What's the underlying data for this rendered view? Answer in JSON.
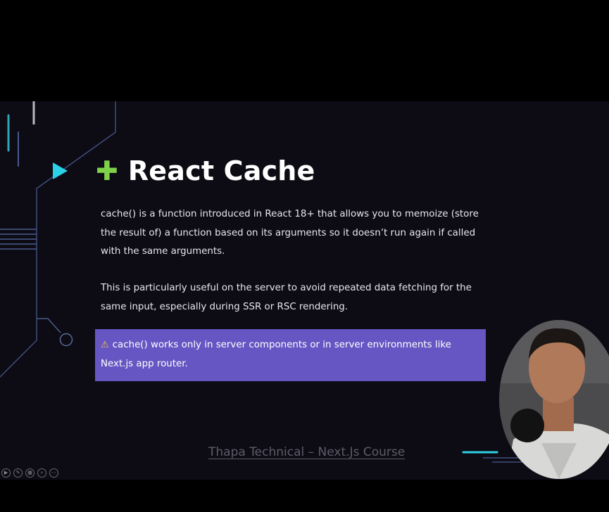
{
  "slide": {
    "title": "React Cache",
    "paragraph_1": "cache() is a function introduced in React 18+ that allows you to memoize (store the result of) a function based on its arguments so it doesn’t run again if called with the same arguments.",
    "paragraph_2": "This is particularly useful on the server to avoid repeated data fetching for the same input, especially during SSR or RSC rendering.",
    "callout": {
      "icon": "warning-icon",
      "text": "cache() works only in server components or in server environments like Next.js app router."
    },
    "footer_credit": "Thapa Technical – Next.Js Course"
  },
  "presentation_controls": [
    {
      "name": "play-icon",
      "glyph": "▶"
    },
    {
      "name": "pen-icon",
      "glyph": "✎"
    },
    {
      "name": "slides-icon",
      "glyph": "▦"
    },
    {
      "name": "zoom-icon",
      "glyph": "⌕"
    },
    {
      "name": "more-icon",
      "glyph": "⋯"
    }
  ],
  "colors": {
    "accent_cyan": "#2bd1e6",
    "callout_bg": "#6656c3",
    "slide_bg": "#0d0b14",
    "deco_line": "#4a5c8c"
  }
}
